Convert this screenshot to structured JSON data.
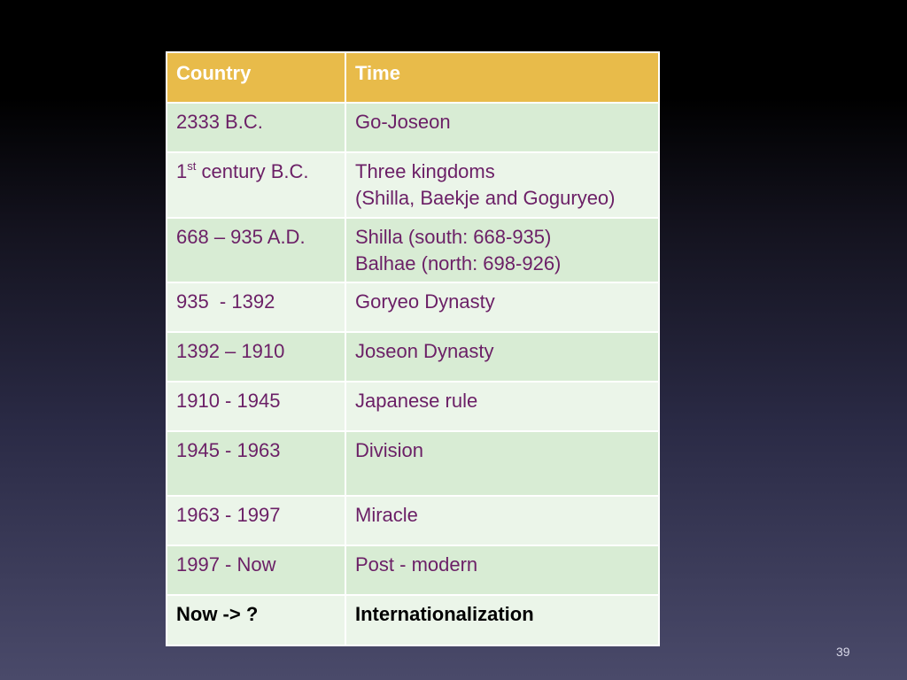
{
  "table": {
    "headers": [
      "Country",
      "Time"
    ],
    "rows": [
      {
        "period": "2333 B.C.",
        "event": "Go-Joseon"
      },
      {
        "period_prefix": "1",
        "period_sup": "st",
        "period_suffix": " century B.C.",
        "event_line1": "Three kingdoms",
        "event_line2": "(Shilla, Baekje and Goguryeo)"
      },
      {
        "period": "668 – 935 A.D.",
        "event_line1": "Shilla (south: 668-935)",
        "event_line2": "Balhae (north: 698-926)"
      },
      {
        "period": "935  - 1392",
        "event": "Goryeo Dynasty"
      },
      {
        "period": "1392 – 1910",
        "event": "Joseon Dynasty"
      },
      {
        "period": "1910 - 1945",
        "event": "Japanese rule"
      },
      {
        "period": "1945 - 1963",
        "event": "Division"
      },
      {
        "period": "1963 - 1997",
        "event": "Miracle"
      },
      {
        "period": "1997 - Now",
        "event": "Post - modern"
      },
      {
        "period": "Now -> ?",
        "event": "Internationalization"
      }
    ]
  },
  "page_number": "39",
  "colors": {
    "header_bg": "#e8bb4a",
    "row_dark": "#d8ecd4",
    "row_light": "#ebf5e9",
    "text": "#6b1f66"
  }
}
